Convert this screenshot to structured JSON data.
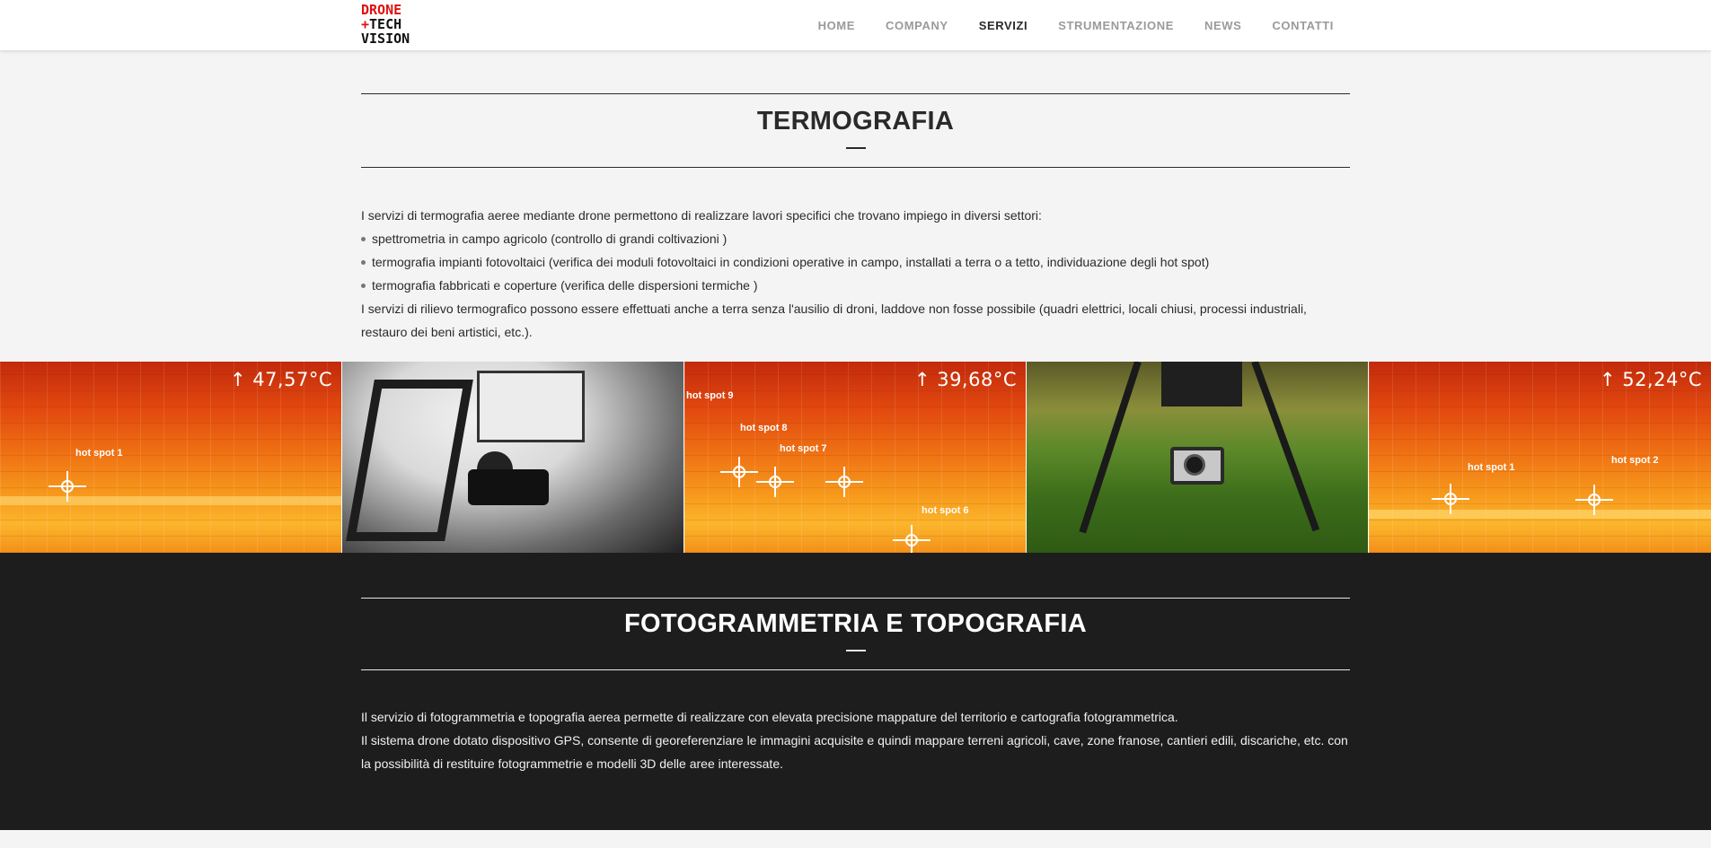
{
  "header": {
    "logo": {
      "line1": "DRONE",
      "line2a": "+",
      "line2b": "TECH",
      "line3": "VISION"
    },
    "nav": [
      {
        "label": "HOME",
        "active": false
      },
      {
        "label": "COMPANY",
        "active": false
      },
      {
        "label": "SERVIZI",
        "active": true
      },
      {
        "label": "STRUMENTAZIONE",
        "active": false
      },
      {
        "label": "NEWS",
        "active": false
      },
      {
        "label": "CONTATTI",
        "active": false
      }
    ]
  },
  "termografia": {
    "title": "TERMOGRAFIA",
    "intro": "I servizi di termografia aeree mediante drone permettono di realizzare lavori specifici che trovano impiego in diversi settori:",
    "items": [
      "spettrometria in campo agricolo (controllo di grandi coltivazioni )",
      "termografia impianti fotovoltaici (verifica dei moduli fotovoltaici in condizioni operative in campo, installati a terra o a tetto, individuazione degli hot spot)",
      "termografia fabbricati e coperture (verifica delle dispersioni termiche )"
    ],
    "outro": "I servizi di rilievo termografico possono essere effettuati anche a terra senza l'ausilio di droni, laddove non fosse possibile (quadri elettrici, locali chiusi, processi industriali, restauro dei beni artistici, etc.)."
  },
  "gallery": {
    "tile1": {
      "temp": "↑ 47,57°C",
      "hotspots": [
        "hot spot 1"
      ]
    },
    "tile3": {
      "temp": "↑ 39,68°C",
      "hotspots": [
        "hot spot 9",
        "hot spot 8",
        "hot spot 7",
        "hot spot 6"
      ]
    },
    "tile5": {
      "temp": "↑ 52,24°C",
      "hotspots": [
        "hot spot 1",
        "hot spot 2"
      ]
    }
  },
  "fotogrammetria": {
    "title": "FOTOGRAMMETRIA E TOPOGRAFIA",
    "paragraph1": "Il servizio di fotogrammetria e topografia aerea permette di realizzare con elevata precisione mappature del territorio e cartografia fotogrammetrica.",
    "paragraph2": "Il sistema drone dotato dispositivo GPS, consente di georeferenziare le immagini acquisite e quindi mappare terreni agricoli, cave, zone franose, cantieri edili, discariche, etc. con la possibilità di restituire fotogrammetrie e modelli 3D delle aree interessate."
  },
  "colors": {
    "accent": "#e01010",
    "dark_section": "#1d1d1d",
    "light_section": "#f4f4f4"
  }
}
